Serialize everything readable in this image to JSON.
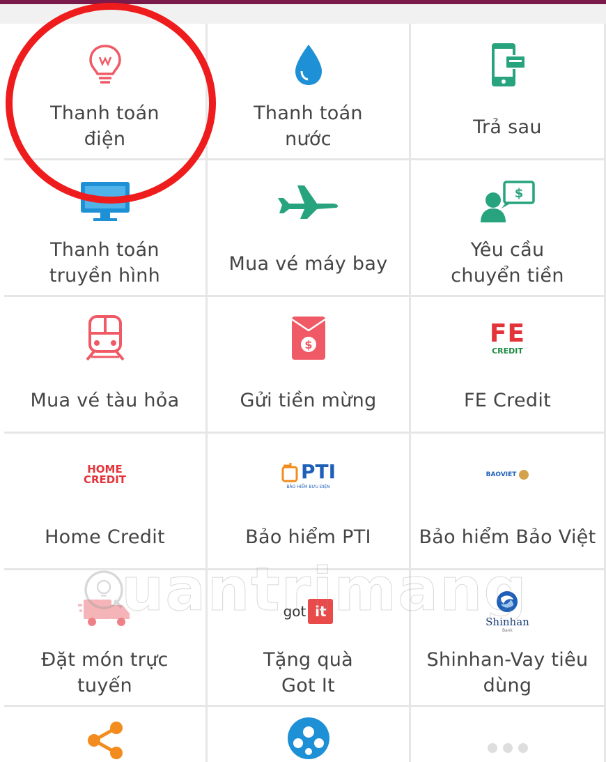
{
  "colors": {
    "header": "#7a1a4a",
    "pink_icon": "#ef5a66",
    "blue_icon": "#1e90d6",
    "green_icon": "#27a37e",
    "highlight_circle": "#ee1c1c"
  },
  "services": [
    {
      "label": "Thanh toán\nđiện",
      "icon": "lightbulb-icon"
    },
    {
      "label": "Thanh toán\nnước",
      "icon": "water-drop-icon"
    },
    {
      "label": "Trả sau",
      "icon": "phone-bill-icon"
    },
    {
      "label": "Thanh toán\ntruyền hình",
      "icon": "tv-monitor-icon"
    },
    {
      "label": "Mua vé máy bay",
      "icon": "airplane-icon"
    },
    {
      "label": "Yêu cầu\nchuyển tiền",
      "icon": "money-request-icon"
    },
    {
      "label": "Mua vé tàu hỏa",
      "icon": "train-icon"
    },
    {
      "label": "Gửi tiền mừng",
      "icon": "red-envelope-icon"
    },
    {
      "label": "FE Credit",
      "icon": "fe-credit-logo",
      "logo_big": "FE",
      "logo_small": "CREDIT"
    },
    {
      "label": "Home Credit",
      "icon": "home-credit-logo",
      "logo_line1": "HOME",
      "logo_line2": "CREDIT"
    },
    {
      "label": "Bảo hiểm PTI",
      "icon": "pti-logo",
      "logo_text": "PTI",
      "logo_sub": "BẢO HIỂM BƯU ĐIỆN"
    },
    {
      "label": "Bảo hiểm Bảo Việt",
      "icon": "baoviet-logo",
      "logo_text": "BAOVIET"
    },
    {
      "label": "Đặt món trực\ntuyến",
      "icon": "delivery-truck-icon"
    },
    {
      "label": "Tặng quà\nGot It",
      "icon": "gotit-logo",
      "logo_got": "got",
      "logo_it": "it"
    },
    {
      "label": "Shinhan-Vay tiêu\ndùng",
      "icon": "shinhan-logo",
      "logo_name": "Shinhan",
      "logo_bank": "Bank"
    },
    {
      "label": "",
      "icon": "share-icon"
    },
    {
      "label": "",
      "icon": "soccer-ball-icon"
    },
    {
      "label": "",
      "icon": "more-dots-icon"
    }
  ],
  "watermark": "uantrimang"
}
